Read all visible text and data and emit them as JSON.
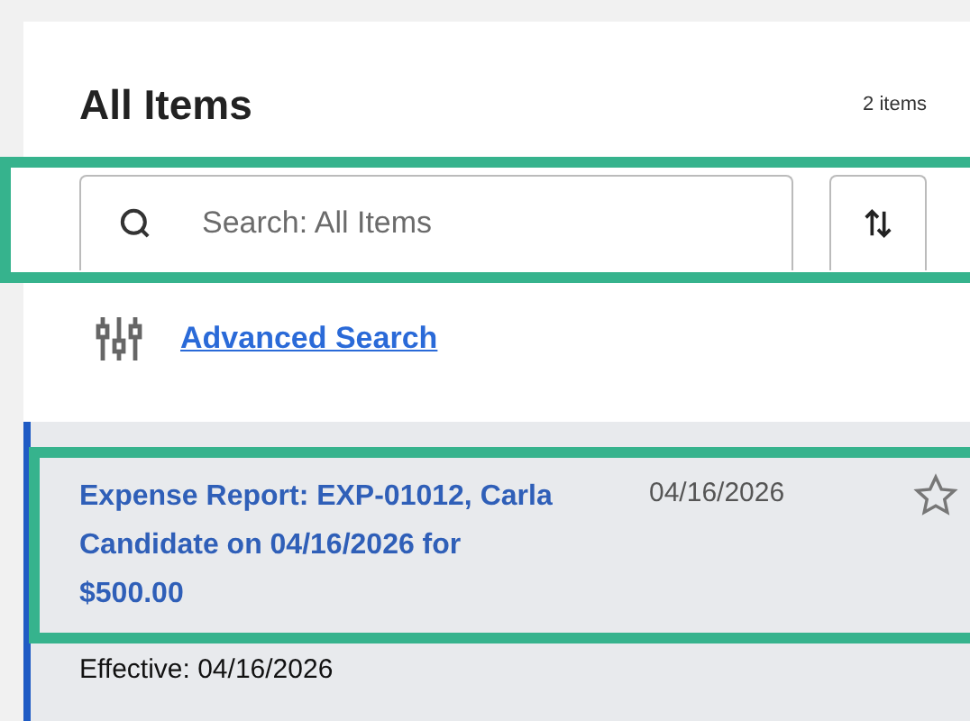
{
  "header": {
    "title": "All Items",
    "count": "2 items"
  },
  "search": {
    "placeholder": "Search: All Items",
    "highlighted": true
  },
  "advanced_search": {
    "label": "Advanced Search"
  },
  "items": [
    {
      "title": "Expense Report: EXP-01012, Carla Candidate on 04/16/2026 for $500.00",
      "date": "04/16/2026",
      "starred": false,
      "selected": true,
      "highlighted": true,
      "effective": "Effective: 04/16/2026"
    }
  ]
}
